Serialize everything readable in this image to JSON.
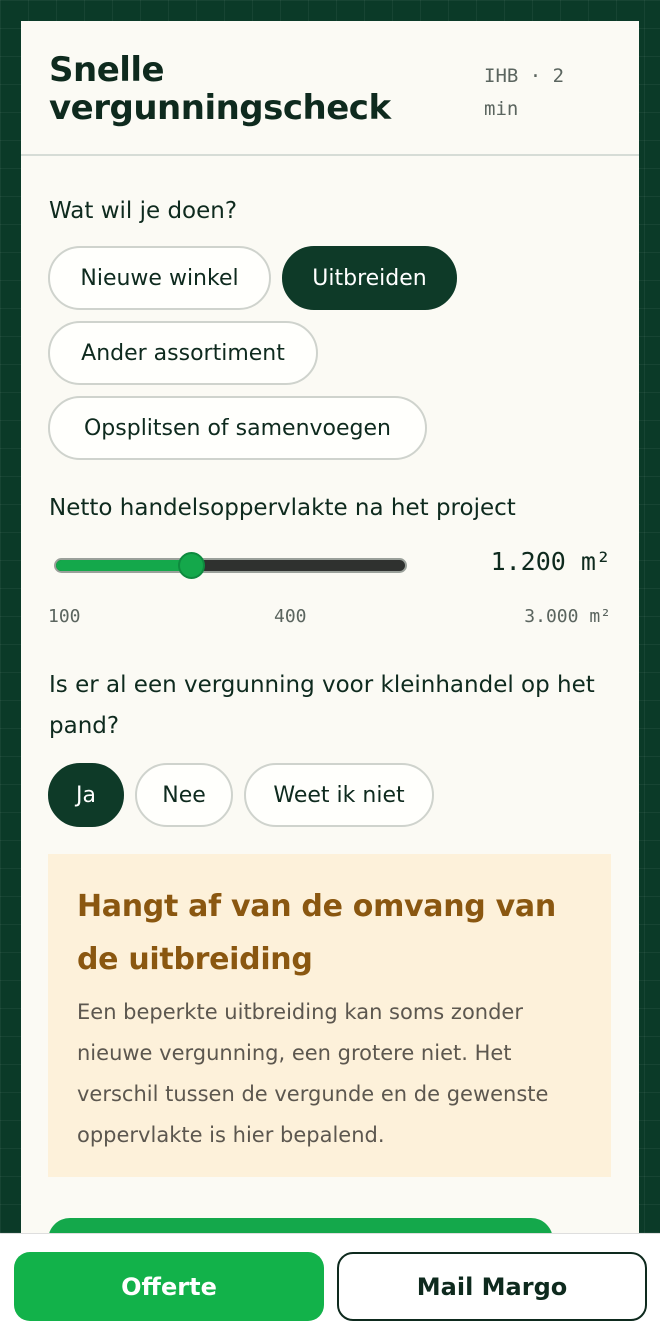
{
  "header": {
    "title": "Snelle vergunningscheck",
    "meta": "IHB · 2 min"
  },
  "q1": {
    "label": "Wat wil je doen?",
    "options": [
      "Nieuwe winkel",
      "Uitbreiden",
      "Ander assortiment",
      "Opsplitsen of samenvoegen"
    ],
    "selected": "Uitbreiden"
  },
  "q2": {
    "label": "Netto handelsoppervlakte na het project",
    "value_display": "1.200 m²",
    "value": 1200,
    "min_label": "100",
    "mid_label": "400",
    "max_label": "3.000 m²",
    "position_fraction": 0.39
  },
  "q3": {
    "label": "Is er al een vergunning voor kleinhandel op het pand?",
    "options": [
      "Ja",
      "Nee",
      "Weet ik niet"
    ],
    "selected": "Ja"
  },
  "notice": {
    "title": "Hangt af van de omvang van de uitbreiding",
    "text": "Een beperkte uitbreiding kan soms zonder nieuwe vergunning, een grotere niet. Het verschil tussen de vergunde en de gewenste oppervlakte is hier bepalend."
  },
  "bottom_bar": {
    "primary_label": "Offerte",
    "secondary_label": "Mail Margo"
  },
  "colors": {
    "background": "#0b3a28",
    "accent_green": "#14a84b",
    "selected_pill": "#0e3a28",
    "notice_bg": "#fdf1da",
    "notice_title": "#8a5710"
  }
}
